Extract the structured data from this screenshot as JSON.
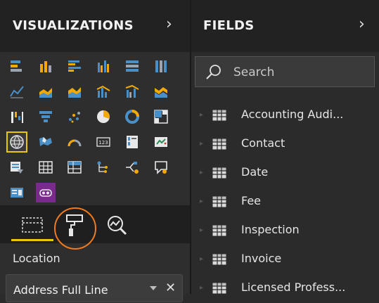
{
  "visualizations": {
    "title": "VISUALIZATIONS",
    "expand_icon": "chevron-right-icon",
    "tiles": [
      "stacked-bar-chart-icon",
      "stacked-column-chart-icon",
      "clustered-bar-chart-icon",
      "clustered-column-chart-icon",
      "100-stacked-bar-chart-icon",
      "100-stacked-column-chart-icon",
      "line-chart-icon",
      "area-chart-icon",
      "stacked-area-chart-icon",
      "line-and-column-chart-icon",
      "line-and-clustered-column-chart-icon",
      "ribbon-chart-icon",
      "waterfall-chart-icon",
      "funnel-icon",
      "scatter-chart-icon",
      "pie-chart-icon",
      "donut-chart-icon",
      "treemap-icon",
      "map-icon",
      "filled-map-icon",
      "gauge-icon",
      "card-icon",
      "multi-row-card-icon",
      "kpi-icon",
      "slicer-icon",
      "table-icon",
      "matrix-icon",
      "key-influencers-icon",
      "decomposition-tree-icon",
      "qa-icon",
      "custom-visual-icon",
      "custom-visual-purple-icon"
    ],
    "selected_tile": "map-icon",
    "format_tabs": {
      "fields_tab": "fields-well-icon",
      "format_tab": "paint-roller-icon",
      "analytics_tab": "analytics-magnifier-icon"
    },
    "well": {
      "label": "Location",
      "value": "Address Full Line",
      "dropdown_icon": "dropdown-arrow-icon",
      "remove_icon": "close-icon"
    }
  },
  "fields": {
    "title": "FIELDS",
    "expand_icon": "chevron-right-icon",
    "search": {
      "placeholder": "Search",
      "value": ""
    },
    "items": [
      {
        "name": "Accounting Audi..."
      },
      {
        "name": "Contact"
      },
      {
        "name": "Date"
      },
      {
        "name": "Fee"
      },
      {
        "name": "Inspection"
      },
      {
        "name": "Invoice"
      },
      {
        "name": "Licensed Profess..."
      }
    ]
  },
  "colors": {
    "accent": "#e8c80b",
    "highlight_circle": "#f07a1e",
    "chart_orange": "#f2a900",
    "chart_blue": "#4a90c8",
    "chart_gray": "#9aa5b1",
    "custom_visual_purple": "#7a2a8c"
  }
}
